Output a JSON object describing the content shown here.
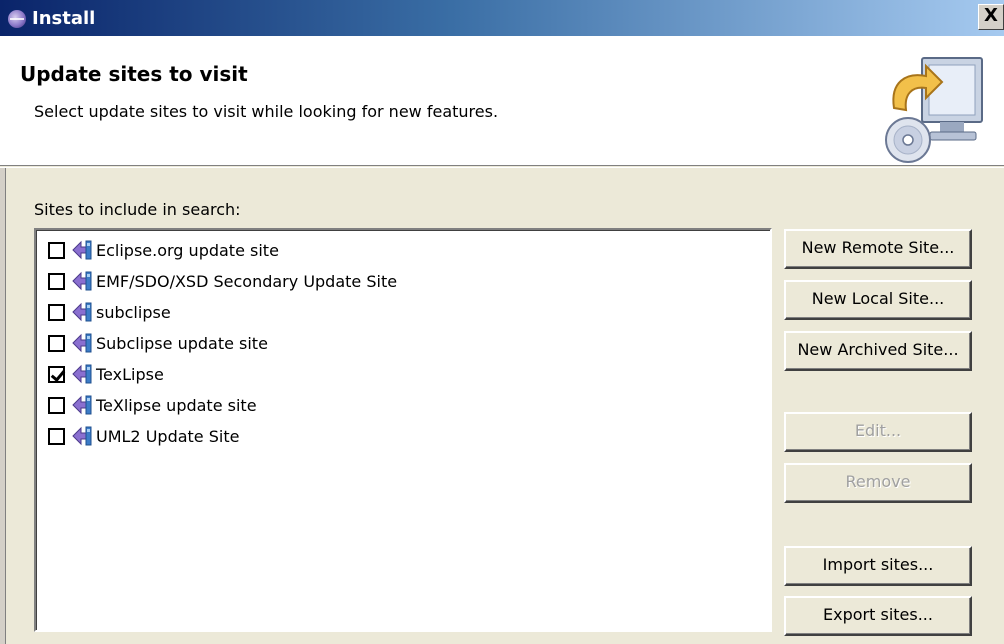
{
  "window": {
    "title": "Install",
    "close_label": "X"
  },
  "banner": {
    "title": "Update sites to visit",
    "description": "Select update sites to visit while looking for new features.",
    "graphic_icon": "install-wizard-icon"
  },
  "sites": {
    "label": "Sites to include in search:",
    "items": [
      {
        "label": "Eclipse.org update site",
        "checked": false,
        "icon": "update-site-icon"
      },
      {
        "label": "EMF/SDO/XSD Secondary Update Site",
        "checked": false,
        "icon": "update-site-icon"
      },
      {
        "label": "subclipse",
        "checked": false,
        "icon": "update-site-icon"
      },
      {
        "label": "Subclipse update site",
        "checked": false,
        "icon": "update-site-icon"
      },
      {
        "label": "TexLipse",
        "checked": true,
        "icon": "update-site-icon"
      },
      {
        "label": "TeXlipse update site",
        "checked": false,
        "icon": "update-site-icon"
      },
      {
        "label": "UML2 Update Site",
        "checked": false,
        "icon": "update-site-icon"
      }
    ]
  },
  "buttons": {
    "new_remote": "New Remote Site...",
    "new_local": "New Local Site...",
    "new_archived": "New Archived Site...",
    "edit": "Edit...",
    "remove": "Remove",
    "import": "Import sites...",
    "export": "Export sites..."
  },
  "colors": {
    "titlebar_start": "#0a246a",
    "titlebar_end": "#a6caf0",
    "dialog_bg": "#ece9d8",
    "disabled_text": "#a0a0a0"
  }
}
